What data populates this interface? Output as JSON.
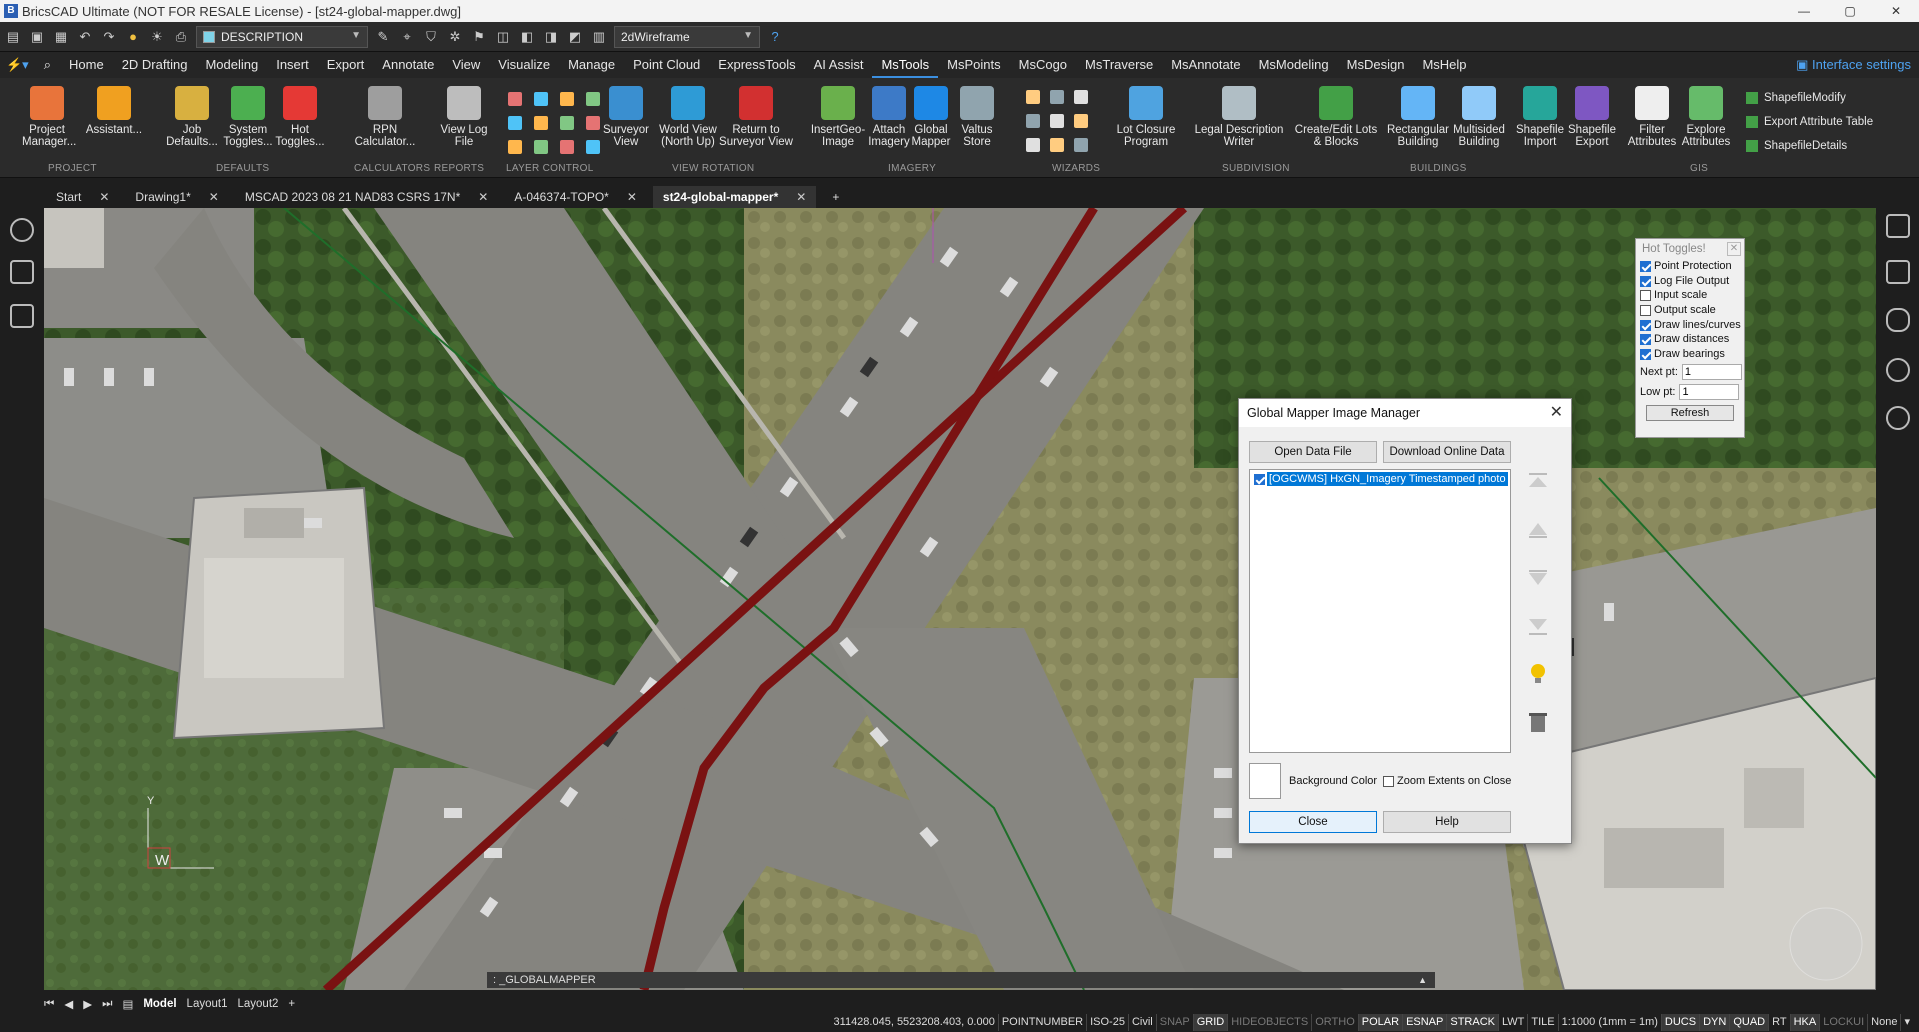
{
  "window": {
    "title": "BricsCAD Ultimate (NOT FOR RESALE License) - [st24-global-mapper.dwg]"
  },
  "quick_access": {
    "layer_value": "DESCRIPTION",
    "visual_style": "2dWireframe"
  },
  "menu": {
    "tabs": [
      "Home",
      "2D Drafting",
      "Modeling",
      "Insert",
      "Export",
      "Annotate",
      "View",
      "Visualize",
      "Manage",
      "Point Cloud",
      "ExpressTools",
      "AI Assist",
      "MsTools",
      "MsPoints",
      "MsCogo",
      "MsTraverse",
      "MsAnnotate",
      "MsModeling",
      "MsDesign",
      "MsHelp"
    ],
    "active": "MsTools",
    "interface_settings": "Interface settings"
  },
  "ribbon": {
    "buttons": [
      {
        "label": "Project Manager...",
        "color": "#e8743b"
      },
      {
        "label": "Assistant...",
        "color": "#f0a020"
      },
      {
        "label": "Job Defaults...",
        "color": "#d8b040"
      },
      {
        "label": "System Toggles...",
        "color": "#4caf50"
      },
      {
        "label": "Hot Toggles...",
        "color": "#e53935"
      },
      {
        "label": "RPN Calculator...",
        "color": "#9e9e9e"
      },
      {
        "label": "View Log File",
        "color": "#bdbdbd"
      },
      {
        "label": "Surveyor View",
        "color": "#3a8fd0"
      },
      {
        "label": "World View (North Up)",
        "color": "#2e9bd6"
      },
      {
        "label": "Return to Surveyor View",
        "color": "#d23030"
      },
      {
        "label": "InsertGeo-Image",
        "color": "#6ab04c"
      },
      {
        "label": "Attach Imagery",
        "color": "#3d7ac7"
      },
      {
        "label": "Global Mapper",
        "color": "#1e88e5"
      },
      {
        "label": "Valtus Store",
        "color": "#90a4ae"
      },
      {
        "label": "Lot Closure Program",
        "color": "#4fa3e0"
      },
      {
        "label": "Legal Description Writer",
        "color": "#b0bec5"
      },
      {
        "label": "Create/Edit Lots & Blocks",
        "color": "#43a047"
      },
      {
        "label": "Rectangular Building",
        "color": "#64b5f6"
      },
      {
        "label": "Multisided Building",
        "color": "#90caf9"
      },
      {
        "label": "Shapefile Import",
        "color": "#26a69a"
      },
      {
        "label": "Shapefile Export",
        "color": "#7e57c2"
      },
      {
        "label": "Filter Attributes",
        "color": "#eeeeee"
      },
      {
        "label": "Explore Attributes",
        "color": "#66bb6a"
      }
    ],
    "gis_items": [
      "ShapefileModify",
      "Export Attribute Table",
      "ShapefileDetails"
    ],
    "groups": [
      "PROJECT",
      "DEFAULTS",
      "CALCULATORS",
      "REPORTS",
      "LAYER CONTROL",
      "VIEW ROTATION",
      "IMAGERY",
      "WIZARDS",
      "SUBDIVISION",
      "BUILDINGS",
      "GIS"
    ]
  },
  "doc_tabs": [
    {
      "label": "Start",
      "active": false
    },
    {
      "label": "Drawing1*",
      "active": false
    },
    {
      "label": "MSCAD 2023 08 21 NAD83 CSRS 17N*",
      "active": false
    },
    {
      "label": "A-046374-TOPO*",
      "active": false
    },
    {
      "label": "st24-global-mapper*",
      "active": true
    }
  ],
  "hot_toggles": {
    "title": "Hot Toggles!",
    "items": [
      {
        "label": "Point Protection",
        "checked": true
      },
      {
        "label": "Log File Output",
        "checked": true
      },
      {
        "label": "Input scale",
        "checked": false
      },
      {
        "label": "Output scale",
        "checked": false
      },
      {
        "label": "Draw lines/curves",
        "checked": true
      },
      {
        "label": "Draw distances",
        "checked": true
      },
      {
        "label": "Draw bearings",
        "checked": true
      }
    ],
    "next_pt_label": "Next pt:",
    "next_pt_value": "1",
    "low_pt_label": "Low pt:",
    "low_pt_value": "1",
    "refresh": "Refresh"
  },
  "dialog": {
    "title": "Global Mapper Image Manager",
    "open_data_file": "Open Data File",
    "download_online_data": "Download Online Data",
    "layer_item": "[OGCWMS] HxGN_Imagery Timestamped photo",
    "background_color": "Background Color",
    "zoom_extents": "Zoom Extents on Close",
    "close": "Close",
    "help": "Help"
  },
  "command_line": ": _GLOBALMAPPER",
  "ucs_label": "W",
  "layout_tabs": [
    "Model",
    "Layout1",
    "Layout2"
  ],
  "status_bar": {
    "coords": "311428.045, 5523208.403, 0.000",
    "items": [
      {
        "label": "POINTNUMBER",
        "state": "normal"
      },
      {
        "label": "ISO-25",
        "state": "normal"
      },
      {
        "label": "Civil",
        "state": "normal"
      },
      {
        "label": "SNAP",
        "state": "off"
      },
      {
        "label": "GRID",
        "state": "on"
      },
      {
        "label": "HIDEOBJECTS",
        "state": "off"
      },
      {
        "label": "ORTHO",
        "state": "off"
      },
      {
        "label": "POLAR",
        "state": "on"
      },
      {
        "label": "ESNAP",
        "state": "on"
      },
      {
        "label": "STRACK",
        "state": "on"
      },
      {
        "label": "LWT",
        "state": "normal"
      },
      {
        "label": "TILE",
        "state": "normal"
      },
      {
        "label": "1:1000 (1mm = 1m)",
        "state": "normal"
      },
      {
        "label": "DUCS",
        "state": "on"
      },
      {
        "label": "DYN",
        "state": "on"
      },
      {
        "label": "QUAD",
        "state": "on"
      },
      {
        "label": "RT",
        "state": "normal"
      },
      {
        "label": "HKA",
        "state": "on"
      },
      {
        "label": "LOCKUI",
        "state": "off"
      },
      {
        "label": "None",
        "state": "normal"
      }
    ]
  }
}
